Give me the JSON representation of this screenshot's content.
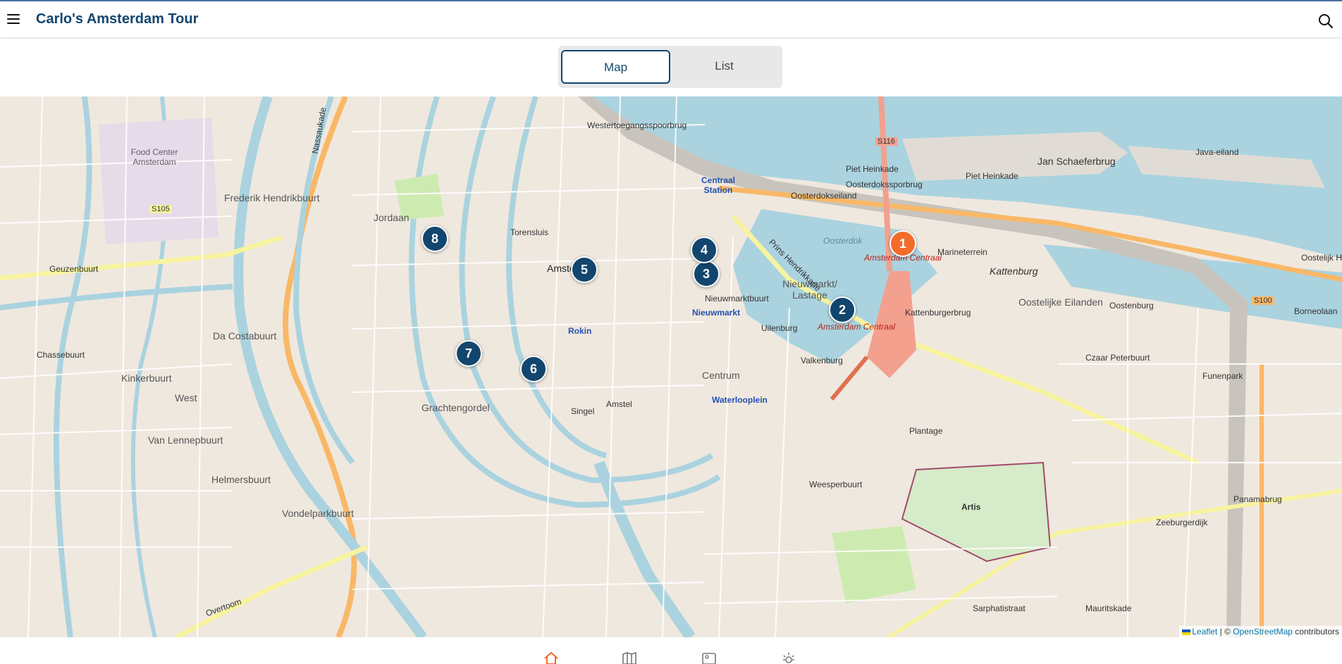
{
  "app": {
    "title": "Carlo's Amsterdam Tour"
  },
  "view_toggle": {
    "map_label": "Map",
    "list_label": "List",
    "selected": "Map"
  },
  "colors": {
    "brand": "#12466e",
    "marker": "#12466e",
    "marker_active": "#f26b2a",
    "water": "#aad3df",
    "land": "#efe8df"
  },
  "map": {
    "markers": [
      {
        "number": "1",
        "active": true
      },
      {
        "number": "2",
        "active": false
      },
      {
        "number": "3",
        "active": false
      },
      {
        "number": "4",
        "active": false
      },
      {
        "number": "5",
        "active": false
      },
      {
        "number": "6",
        "active": false
      },
      {
        "number": "7",
        "active": false
      },
      {
        "number": "8",
        "active": false
      }
    ],
    "labels": {
      "westertoegangsspoorbrug": "Westertoegangsspoorbrug",
      "oosterdokssporbrug": "Oosterdokssporbrug",
      "piet_heinkade": "Piet Heinkade",
      "jan_schaeferbrug": "Jan Schaeferbrug",
      "java_eiland": "Java-eiland",
      "food_center": "Food Center Amsterdam",
      "frederik": "Frederik Hendrikbuurt",
      "jordaan": "Jordaan",
      "torensluis": "Torensluis",
      "amsterdam": "Amsterdam",
      "amsterdam_centraal_1": "Amsterdam Centraal",
      "amsterdam_centraal_2": "Amsterdam Centraal",
      "centraal_station": "Centraal Station",
      "oosterdokseiland": "Oosterdokseiland",
      "oosterdok": "Oosterdok",
      "marineterrein": "Marineterrein",
      "kattenburg": "Kattenburg",
      "kattenburgerbrug": "Kattenburgerbrug",
      "oostelijke_eilanden": "Oostelijke Eilanden",
      "oostenburg": "Oostenburg",
      "nieuwmarkt_lastage": "Nieuwmarkt/ Lastage",
      "nieuwmarktbuurt": "Nieuwmarktbuurt",
      "nieuwmarkt": "Nieuwmarkt",
      "uilenburg": "Uilenburg",
      "rokin": "Rokin",
      "valkenburg": "Valkenburg",
      "centrum": "Centrum",
      "waterlooplein": "Waterlooplein",
      "geuzenbuurt": "Geuzenbuurt",
      "da_costabuurt": "Da Costabuurt",
      "chassebuurt": "Chassebuurt",
      "kinkerbuurt": "Kinkerbuurt",
      "west": "West",
      "grachtengordel": "Grachtengordel",
      "van_lennepbuurt": "Van Lennepbuurt",
      "helmersbuurt": "Helmersbuurt",
      "vondelparkbuurt": "Vondelparkbuurt",
      "weesperbuurt": "Weesperbuurt",
      "plantage": "Plantage",
      "artis": "Artis",
      "czaar_peterbuurt": "Czaar Peterbuurt",
      "funenpark": "Funenpark",
      "panamabrug": "Panamabrug",
      "zeeburgerdijk": "Zeeburgerdijk",
      "mauritskade": "Mauritskade",
      "sarphatistraat": "Sarphatistraat",
      "nassaukade": "Nassaukade",
      "prins_hendrikkade": "Prins Hendrikkade",
      "overtoom": "Overtoom",
      "amstel": "Amstel",
      "singel": "Singel",
      "s105": "S105",
      "s116": "S116",
      "s100": "S100",
      "borneolaan": "Borneolaan",
      "oostelijk_haven": "Oostelijk Have"
    },
    "attribution": {
      "leaflet": "Leaflet",
      "separator": "| ©",
      "osm": "OpenStreetMap",
      "contributors": "contributors"
    }
  },
  "bottom_nav": {
    "items": [
      {
        "icon": "home-icon",
        "active": true
      },
      {
        "icon": "map-icon",
        "active": false
      },
      {
        "icon": "image-icon",
        "active": false
      },
      {
        "icon": "gear-icon",
        "active": false
      }
    ]
  }
}
